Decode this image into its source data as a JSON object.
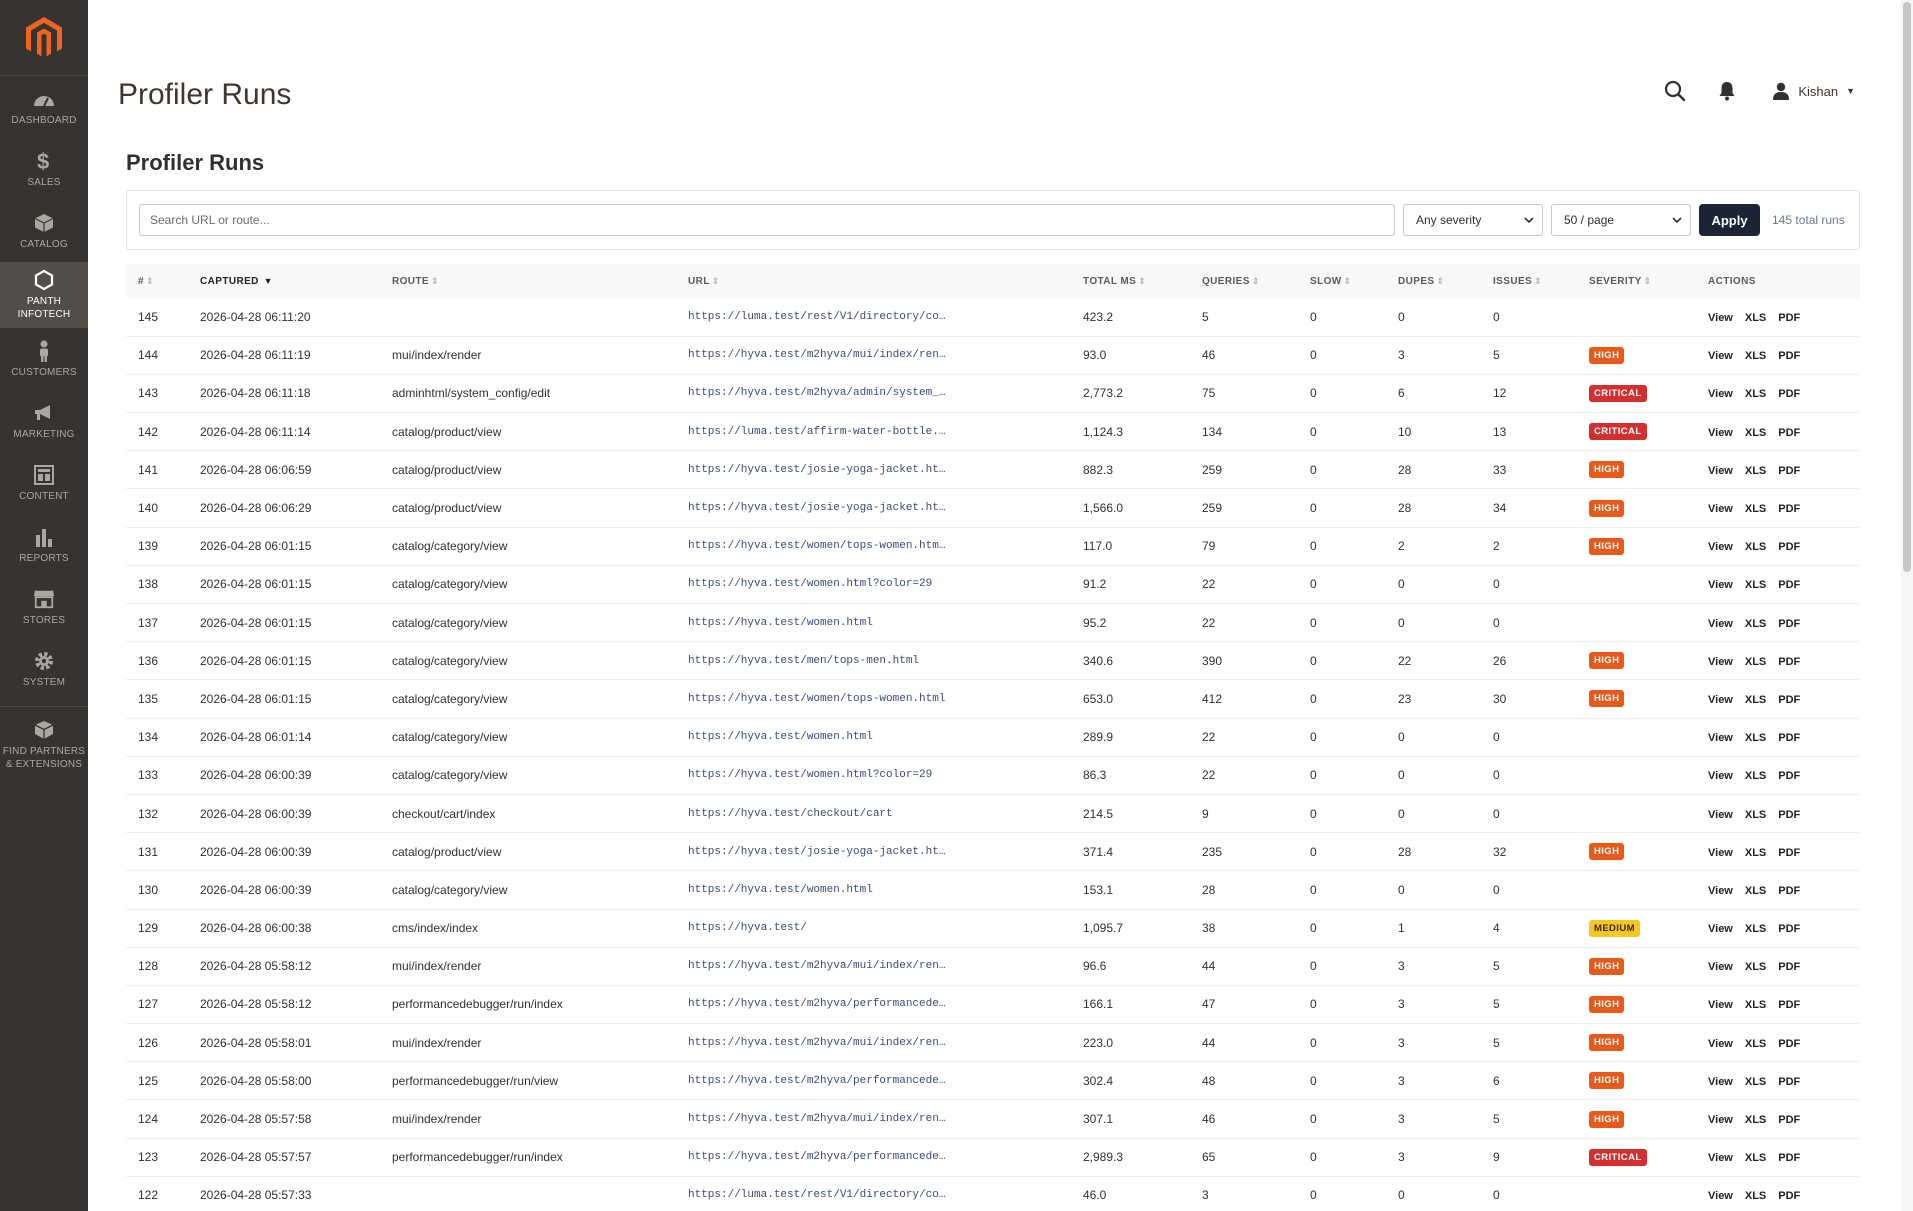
{
  "sidebar": {
    "items": [
      {
        "name": "dashboard",
        "label": "DASHBOARD",
        "icon": "speedometer-icon"
      },
      {
        "name": "sales",
        "label": "SALES",
        "icon": "dollar-icon"
      },
      {
        "name": "catalog",
        "label": "CATALOG",
        "icon": "box-icon"
      },
      {
        "name": "panth-infotech",
        "label": "PANTH INFOTECH",
        "icon": "hexagon-icon",
        "active": true
      },
      {
        "name": "customers",
        "label": "CUSTOMERS",
        "icon": "person-icon"
      },
      {
        "name": "marketing",
        "label": "MARKETING",
        "icon": "megaphone-icon"
      },
      {
        "name": "content",
        "label": "CONTENT",
        "icon": "layout-icon"
      },
      {
        "name": "reports",
        "label": "REPORTS",
        "icon": "bar-chart-icon"
      },
      {
        "name": "stores",
        "label": "STORES",
        "icon": "storefront-icon"
      },
      {
        "name": "system",
        "label": "SYSTEM",
        "icon": "gear-icon"
      },
      {
        "name": "find-partners",
        "label": "FIND PARTNERS & EXTENSIONS",
        "icon": "cubes-icon"
      }
    ]
  },
  "header": {
    "title": "Profiler Runs",
    "user": "Kishan"
  },
  "section_title": "Profiler Runs",
  "filters": {
    "search_placeholder": "Search URL or route...",
    "severity": "Any severity",
    "per_page": "50 / page",
    "apply": "Apply",
    "total": "145 total runs"
  },
  "table": {
    "columns": [
      "#",
      "CAPTURED",
      "ROUTE",
      "URL",
      "TOTAL MS",
      "QUERIES",
      "SLOW",
      "DUPES",
      "ISSUES",
      "SEVERITY",
      "ACTIONS"
    ],
    "actions": [
      "View",
      "XLS",
      "PDF"
    ],
    "rows": [
      {
        "id": "145",
        "captured": "2026-04-28 06:11:20",
        "route": "",
        "url": "https://luma.test/rest/V1/directory/co…",
        "total_ms": "423.2",
        "queries": "5",
        "slow": "0",
        "dupes": "0",
        "issues": "0",
        "severity": ""
      },
      {
        "id": "144",
        "captured": "2026-04-28 06:11:19",
        "route": "mui/index/render",
        "url": "https://hyva.test/m2hyva/mui/index/ren…",
        "total_ms": "93.0",
        "queries": "46",
        "slow": "0",
        "dupes": "3",
        "issues": "5",
        "severity": "HIGH"
      },
      {
        "id": "143",
        "captured": "2026-04-28 06:11:18",
        "route": "adminhtml/system_config/edit",
        "url": "https://hyva.test/m2hyva/admin/system_…",
        "total_ms": "2,773.2",
        "queries": "75",
        "slow": "0",
        "dupes": "6",
        "issues": "12",
        "severity": "CRITICAL"
      },
      {
        "id": "142",
        "captured": "2026-04-28 06:11:14",
        "route": "catalog/product/view",
        "url": "https://luma.test/affirm-water-bottle.…",
        "total_ms": "1,124.3",
        "queries": "134",
        "slow": "0",
        "dupes": "10",
        "issues": "13",
        "severity": "CRITICAL"
      },
      {
        "id": "141",
        "captured": "2026-04-28 06:06:59",
        "route": "catalog/product/view",
        "url": "https://hyva.test/josie-yoga-jacket.ht…",
        "total_ms": "882.3",
        "queries": "259",
        "slow": "0",
        "dupes": "28",
        "issues": "33",
        "severity": "HIGH"
      },
      {
        "id": "140",
        "captured": "2026-04-28 06:06:29",
        "route": "catalog/product/view",
        "url": "https://hyva.test/josie-yoga-jacket.ht…",
        "total_ms": "1,566.0",
        "queries": "259",
        "slow": "0",
        "dupes": "28",
        "issues": "34",
        "severity": "HIGH"
      },
      {
        "id": "139",
        "captured": "2026-04-28 06:01:15",
        "route": "catalog/category/view",
        "url": "https://hyva.test/women/tops-women.htm…",
        "total_ms": "117.0",
        "queries": "79",
        "slow": "0",
        "dupes": "2",
        "issues": "2",
        "severity": "HIGH"
      },
      {
        "id": "138",
        "captured": "2026-04-28 06:01:15",
        "route": "catalog/category/view",
        "url": "https://hyva.test/women.html?color=29",
        "total_ms": "91.2",
        "queries": "22",
        "slow": "0",
        "dupes": "0",
        "issues": "0",
        "severity": ""
      },
      {
        "id": "137",
        "captured": "2026-04-28 06:01:15",
        "route": "catalog/category/view",
        "url": "https://hyva.test/women.html",
        "total_ms": "95.2",
        "queries": "22",
        "slow": "0",
        "dupes": "0",
        "issues": "0",
        "severity": ""
      },
      {
        "id": "136",
        "captured": "2026-04-28 06:01:15",
        "route": "catalog/category/view",
        "url": "https://hyva.test/men/tops-men.html",
        "total_ms": "340.6",
        "queries": "390",
        "slow": "0",
        "dupes": "22",
        "issues": "26",
        "severity": "HIGH"
      },
      {
        "id": "135",
        "captured": "2026-04-28 06:01:15",
        "route": "catalog/category/view",
        "url": "https://hyva.test/women/tops-women.html",
        "total_ms": "653.0",
        "queries": "412",
        "slow": "0",
        "dupes": "23",
        "issues": "30",
        "severity": "HIGH"
      },
      {
        "id": "134",
        "captured": "2026-04-28 06:01:14",
        "route": "catalog/category/view",
        "url": "https://hyva.test/women.html",
        "total_ms": "289.9",
        "queries": "22",
        "slow": "0",
        "dupes": "0",
        "issues": "0",
        "severity": ""
      },
      {
        "id": "133",
        "captured": "2026-04-28 06:00:39",
        "route": "catalog/category/view",
        "url": "https://hyva.test/women.html?color=29",
        "total_ms": "86.3",
        "queries": "22",
        "slow": "0",
        "dupes": "0",
        "issues": "0",
        "severity": ""
      },
      {
        "id": "132",
        "captured": "2026-04-28 06:00:39",
        "route": "checkout/cart/index",
        "url": "https://hyva.test/checkout/cart",
        "total_ms": "214.5",
        "queries": "9",
        "slow": "0",
        "dupes": "0",
        "issues": "0",
        "severity": ""
      },
      {
        "id": "131",
        "captured": "2026-04-28 06:00:39",
        "route": "catalog/product/view",
        "url": "https://hyva.test/josie-yoga-jacket.ht…",
        "total_ms": "371.4",
        "queries": "235",
        "slow": "0",
        "dupes": "28",
        "issues": "32",
        "severity": "HIGH"
      },
      {
        "id": "130",
        "captured": "2026-04-28 06:00:39",
        "route": "catalog/category/view",
        "url": "https://hyva.test/women.html",
        "total_ms": "153.1",
        "queries": "28",
        "slow": "0",
        "dupes": "0",
        "issues": "0",
        "severity": ""
      },
      {
        "id": "129",
        "captured": "2026-04-28 06:00:38",
        "route": "cms/index/index",
        "url": "https://hyva.test/",
        "total_ms": "1,095.7",
        "queries": "38",
        "slow": "0",
        "dupes": "1",
        "issues": "4",
        "severity": "MEDIUM"
      },
      {
        "id": "128",
        "captured": "2026-04-28 05:58:12",
        "route": "mui/index/render",
        "url": "https://hyva.test/m2hyva/mui/index/ren…",
        "total_ms": "96.6",
        "queries": "44",
        "slow": "0",
        "dupes": "3",
        "issues": "5",
        "severity": "HIGH"
      },
      {
        "id": "127",
        "captured": "2026-04-28 05:58:12",
        "route": "performancedebugger/run/index",
        "url": "https://hyva.test/m2hyva/performancede…",
        "total_ms": "166.1",
        "queries": "47",
        "slow": "0",
        "dupes": "3",
        "issues": "5",
        "severity": "HIGH"
      },
      {
        "id": "126",
        "captured": "2026-04-28 05:58:01",
        "route": "mui/index/render",
        "url": "https://hyva.test/m2hyva/mui/index/ren…",
        "total_ms": "223.0",
        "queries": "44",
        "slow": "0",
        "dupes": "3",
        "issues": "5",
        "severity": "HIGH"
      },
      {
        "id": "125",
        "captured": "2026-04-28 05:58:00",
        "route": "performancedebugger/run/view",
        "url": "https://hyva.test/m2hyva/performancede…",
        "total_ms": "302.4",
        "queries": "48",
        "slow": "0",
        "dupes": "3",
        "issues": "6",
        "severity": "HIGH"
      },
      {
        "id": "124",
        "captured": "2026-04-28 05:57:58",
        "route": "mui/index/render",
        "url": "https://hyva.test/m2hyva/mui/index/ren…",
        "total_ms": "307.1",
        "queries": "46",
        "slow": "0",
        "dupes": "3",
        "issues": "5",
        "severity": "HIGH"
      },
      {
        "id": "123",
        "captured": "2026-04-28 05:57:57",
        "route": "performancedebugger/run/index",
        "url": "https://hyva.test/m2hyva/performancede…",
        "total_ms": "2,989.3",
        "queries": "65",
        "slow": "0",
        "dupes": "3",
        "issues": "9",
        "severity": "CRITICAL"
      },
      {
        "id": "122",
        "captured": "2026-04-28 05:57:33",
        "route": "",
        "url": "https://luma.test/rest/V1/directory/co…",
        "total_ms": "46.0",
        "queries": "3",
        "slow": "0",
        "dupes": "0",
        "issues": "0",
        "severity": ""
      }
    ]
  }
}
